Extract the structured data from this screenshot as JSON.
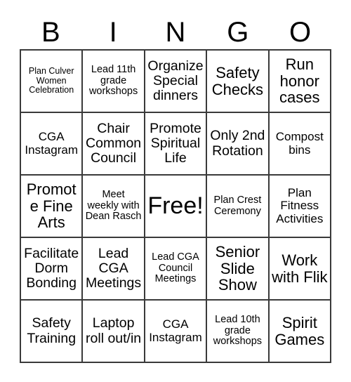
{
  "header": {
    "letters": [
      "B",
      "I",
      "N",
      "G",
      "O"
    ]
  },
  "grid": {
    "columns": 5,
    "rows": 5,
    "free_space_index": 12,
    "cells": [
      {
        "text": "Plan Culver Women Celebration",
        "size": "xs"
      },
      {
        "text": "Lead 11th grade workshops",
        "size": "s"
      },
      {
        "text": "Organize Special dinners",
        "size": "l"
      },
      {
        "text": "Safety Checks",
        "size": "xl"
      },
      {
        "text": "Run honor cases",
        "size": "xl"
      },
      {
        "text": "CGA Instagram",
        "size": "m"
      },
      {
        "text": "Chair Common Council",
        "size": "l"
      },
      {
        "text": "Promote Spiritual Life",
        "size": "l"
      },
      {
        "text": "Only 2nd Rotation",
        "size": "l"
      },
      {
        "text": "Compost bins",
        "size": "m"
      },
      {
        "text": "Promote Fine Arts",
        "size": "xl"
      },
      {
        "text": "Meet weekly with Dean Rasch",
        "size": "s"
      },
      {
        "text": "Free!",
        "size": "free"
      },
      {
        "text": "Plan Crest Ceremony",
        "size": "s"
      },
      {
        "text": "Plan Fitness Activities",
        "size": "m"
      },
      {
        "text": "Facilitate Dorm Bonding",
        "size": "l"
      },
      {
        "text": "Lead CGA Meetings",
        "size": "l"
      },
      {
        "text": "Lead CGA Council Meetings",
        "size": "s"
      },
      {
        "text": "Senior Slide Show",
        "size": "xl"
      },
      {
        "text": "Work with Flik",
        "size": "xl"
      },
      {
        "text": "Safety Training",
        "size": "l"
      },
      {
        "text": "Laptop roll out/in",
        "size": "l"
      },
      {
        "text": "CGA Instagram",
        "size": "m"
      },
      {
        "text": "Lead 10th grade workshops",
        "size": "s"
      },
      {
        "text": "Spirit Games",
        "size": "xl"
      }
    ]
  },
  "colors": {
    "background": "#ffffff",
    "text": "#000000",
    "grid_line": "#3a3a3a"
  }
}
